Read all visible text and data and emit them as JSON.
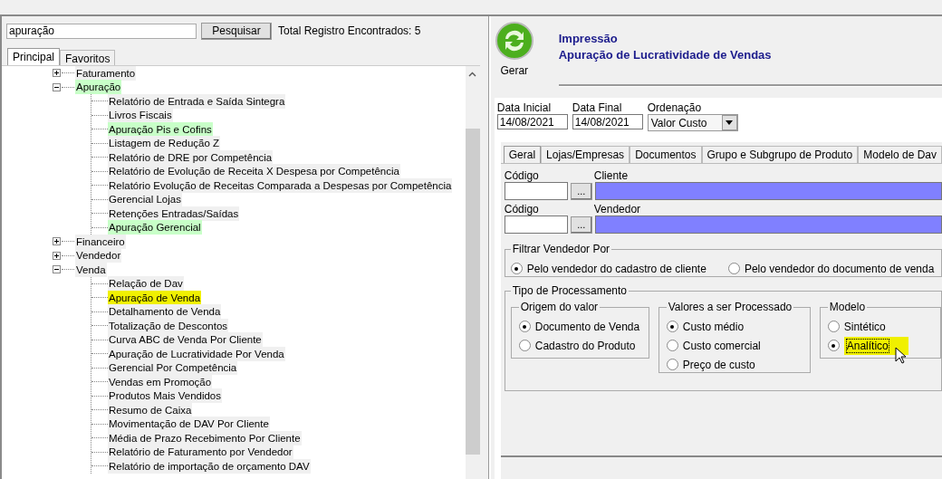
{
  "search": {
    "value": "apuração",
    "button": "Pesquisar",
    "result": "Total Registro Encontrados: 5"
  },
  "left_tabs": [
    {
      "label": "Principal",
      "selected": true
    },
    {
      "label": "Favoritos",
      "selected": false
    }
  ],
  "tree": [
    {
      "label": "Faturamento",
      "expanded": false
    },
    {
      "label": "Apuração",
      "expanded": true,
      "color": "#c8ffc8",
      "children": [
        {
          "label": "Relatório de Entrada e Saída Sintegra"
        },
        {
          "label": "Livros Fiscais"
        },
        {
          "label": "Apuração Pis e Cofins",
          "color": "#c8ffc8"
        },
        {
          "label": "Listagem de Redução Z"
        },
        {
          "label": "Relatório de DRE por Competência"
        },
        {
          "label": "Relatório de Evolução de Receita X Despesa por Competência"
        },
        {
          "label": "Relatório Evolução de Receitas Comparada a Despesas por Competência"
        },
        {
          "label": "Gerencial Lojas"
        },
        {
          "label": "Retenções Entradas/Saídas"
        },
        {
          "label": "Apuração Gerencial",
          "color": "#c8ffc8"
        }
      ]
    },
    {
      "label": "Financeiro",
      "expanded": false
    },
    {
      "label": "Vendedor",
      "expanded": false
    },
    {
      "label": "Venda",
      "expanded": true,
      "children": [
        {
          "label": "Relação de Dav"
        },
        {
          "label": "Apuração de Venda",
          "color": "#f0f000"
        },
        {
          "label": "Detalhamento de Venda"
        },
        {
          "label": "Totalização de Descontos"
        },
        {
          "label": "Curva ABC de Venda Por Cliente"
        },
        {
          "label": "Apuração de Lucratividade Por Venda"
        },
        {
          "label": "Gerencial Por Competência"
        },
        {
          "label": "Vendas em Promoção"
        },
        {
          "label": "Produtos Mais Vendidos"
        },
        {
          "label": "Resumo de Caixa"
        },
        {
          "label": "Movimentação de DAV Por Cliente"
        },
        {
          "label": "Média de Prazo Recebimento Por Cliente"
        },
        {
          "label": "Relatório de Faturamento por Vendedor"
        },
        {
          "label": "Relatório de importação de orçamento DAV"
        }
      ]
    }
  ],
  "generate_button": "Gerar",
  "header": {
    "title": "Impressão",
    "subtitle": "Apuração de Lucratividade de Vendas"
  },
  "date_fields": [
    {
      "label": "Data Inicial",
      "value": "14/08/2021"
    },
    {
      "label": "Data Final",
      "value": "14/08/2021"
    }
  ],
  "ordering": {
    "label": "Ordenação",
    "value": "Valor Custo"
  },
  "tabs": [
    {
      "label": "Geral",
      "selected": true
    },
    {
      "label": "Lojas/Empresas",
      "selected": false
    },
    {
      "label": "Documentos",
      "selected": false
    },
    {
      "label": "Grupo e Subgrupo de Produto",
      "selected": false
    },
    {
      "label": "Modelo de Dav",
      "selected": false
    }
  ],
  "lookups": [
    {
      "code_label": "Código",
      "name_label": "Cliente",
      "button": "..."
    },
    {
      "code_label": "Código",
      "name_label": "Vendedor",
      "button": "..."
    }
  ],
  "filter_group": {
    "title": "Filtrar Vendedor Por",
    "options": [
      {
        "label": "Pelo vendedor do cadastro de cliente",
        "selected": true
      },
      {
        "label": "Pelo vendedor do documento de venda",
        "selected": false
      }
    ]
  },
  "processing": {
    "title": "Tipo de Processamento",
    "groups": [
      {
        "title": "Origem do valor",
        "options": [
          {
            "label": "Documento de Venda",
            "selected": true,
            "highlighted": false
          },
          {
            "label": "Cadastro do Produto",
            "selected": false,
            "highlighted": false
          }
        ]
      },
      {
        "title": "Valores a ser Processado",
        "options": [
          {
            "label": "Custo médio",
            "selected": true,
            "highlighted": false
          },
          {
            "label": "Custo comercial",
            "selected": false,
            "highlighted": false
          },
          {
            "label": "Preço de custo",
            "selected": false,
            "highlighted": false
          }
        ]
      },
      {
        "title": "Modelo",
        "options": [
          {
            "label": "Sintético",
            "selected": false,
            "highlighted": false
          },
          {
            "label": "Analítico",
            "selected": true,
            "highlighted": true
          }
        ]
      }
    ]
  }
}
